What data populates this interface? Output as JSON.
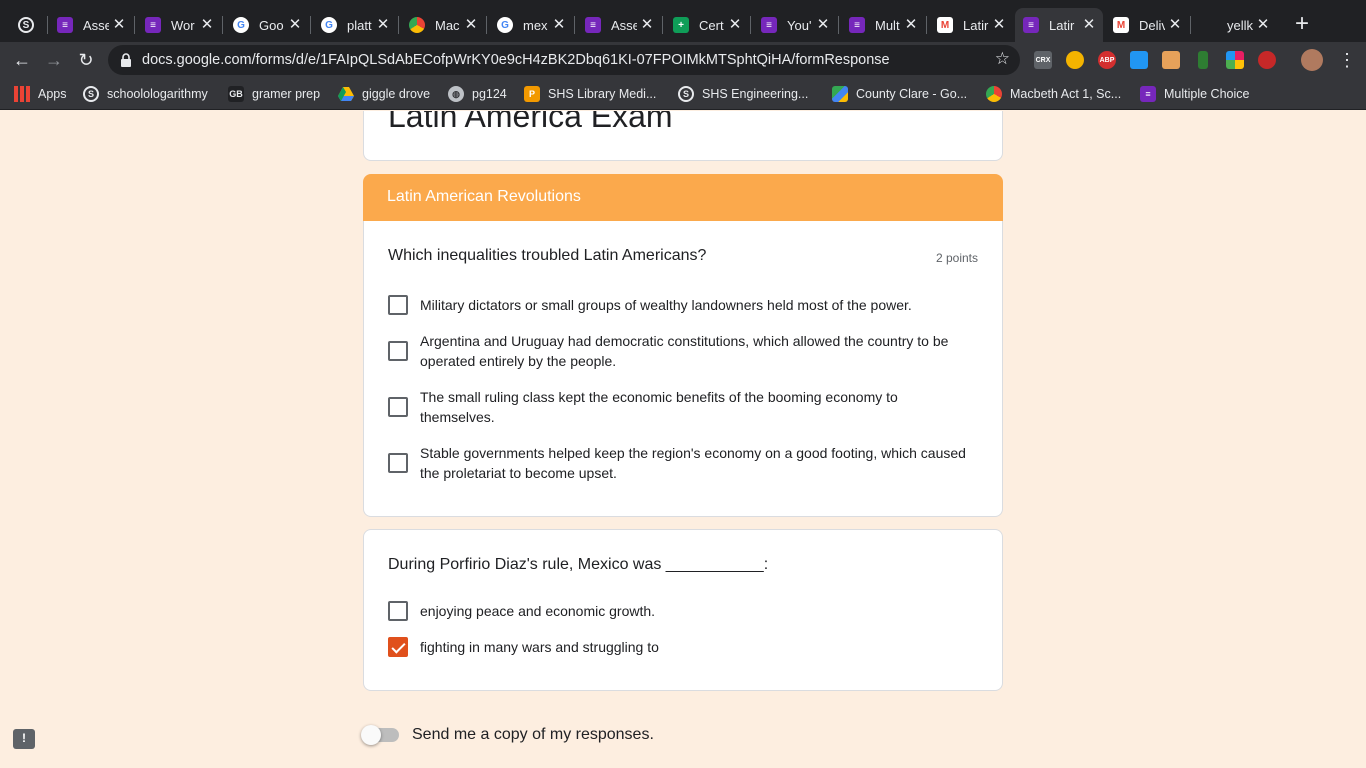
{
  "browser": {
    "tabs": [
      {
        "label": "",
        "icon": "shs-icon",
        "color": "#202124"
      },
      {
        "label": "Asse",
        "icon": "forms-icon",
        "color": "#7627bb"
      },
      {
        "label": "Wor",
        "icon": "forms-icon",
        "color": "#7627bb"
      },
      {
        "label": "Goo",
        "icon": "google-icon",
        "color": "#ffffff"
      },
      {
        "label": "platt",
        "icon": "google-icon",
        "color": "#ffffff"
      },
      {
        "label": "Mac",
        "icon": "macbeth-icon",
        "color": "#ffffff"
      },
      {
        "label": "mex",
        "icon": "google-icon",
        "color": "#ffffff"
      },
      {
        "label": "Asse",
        "icon": "forms-icon",
        "color": "#7627bb"
      },
      {
        "label": "Cert",
        "icon": "sheets-icon",
        "color": "#0f9d58"
      },
      {
        "label": "You'",
        "icon": "forms-icon",
        "color": "#7627bb"
      },
      {
        "label": "Mult",
        "icon": "forms-icon",
        "color": "#7627bb"
      },
      {
        "label": "Latir",
        "icon": "gmail-icon",
        "color": "#ffffff"
      },
      {
        "label": "Latir",
        "icon": "forms-icon",
        "color": "#7627bb",
        "active": true
      },
      {
        "label": "Deliv",
        "icon": "gmail-icon",
        "color": "#ffffff"
      },
      {
        "label": "yellk",
        "icon": "blank-icon",
        "color": "#202124"
      }
    ],
    "url": "docs.google.com/forms/d/e/1FAIpQLSdAbECofpWrKY0e9cH4zBK2Dbq61KI-07FPOIMkMTSphtQiHA/formResponse",
    "extensions": [
      "CRX",
      "",
      "ABP",
      "",
      "",
      "",
      "",
      ""
    ],
    "bookmarks": [
      {
        "label": "Apps",
        "icon": "apps-grid-icon"
      },
      {
        "label": "schoolologarithmy",
        "icon": "schoology-icon"
      },
      {
        "label": "gramer prep",
        "icon": "gb-icon"
      },
      {
        "label": "giggle drove",
        "icon": "drive-icon"
      },
      {
        "label": "pg124",
        "icon": "globe-icon"
      },
      {
        "label": "SHS Library Medi...",
        "icon": "library-icon"
      },
      {
        "label": "SHS Engineering...",
        "icon": "schoology-icon"
      },
      {
        "label": "County Clare - Go...",
        "icon": "maps-icon"
      },
      {
        "label": "Macbeth Act 1, Sc...",
        "icon": "macbeth-icon"
      },
      {
        "label": "Multiple Choice",
        "icon": "forms-icon"
      }
    ]
  },
  "form": {
    "title": "Latin America Exam",
    "section_title": "Latin American Revolutions",
    "accent_color": "#fba94c",
    "check_color": "#e0501c",
    "questions": [
      {
        "text": "Which inequalities troubled Latin Americans?",
        "points": "2 points",
        "options": [
          {
            "text": "Military dictators or small groups of wealthy landowners held most of the power.",
            "checked": false
          },
          {
            "text": "Argentina and Uruguay had democratic constitutions, which allowed the country to be operated entirely by the people.",
            "checked": false
          },
          {
            "text": "The small ruling class kept the economic benefits of the booming economy to themselves.",
            "checked": false
          },
          {
            "text": "Stable governments helped keep the region's economy on a good footing, which caused the proletariat to become upset.",
            "checked": false
          }
        ]
      },
      {
        "text": "During Porfirio Diaz's rule, Mexico was ___________:",
        "points": "",
        "options": [
          {
            "text": "enjoying peace and economic growth.",
            "checked": false
          },
          {
            "text": "fighting in many wars and struggling to",
            "checked": true
          }
        ]
      }
    ],
    "send_copy_label": "Send me a copy of my responses.",
    "send_copy_on": false
  },
  "feedback_icon": "!"
}
